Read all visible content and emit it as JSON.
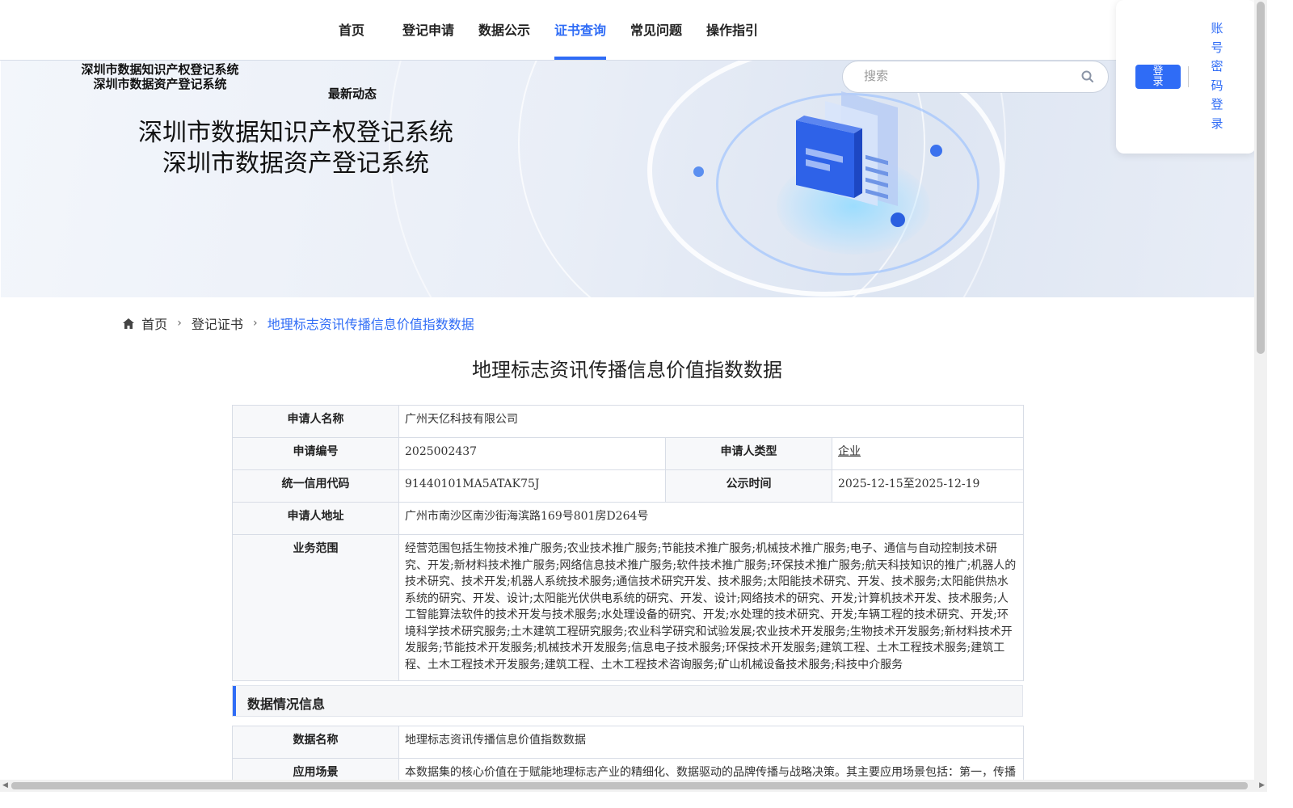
{
  "nav": {
    "items": [
      {
        "label": "首页"
      },
      {
        "label": "登记申请"
      },
      {
        "label": "数据公示"
      },
      {
        "label": "证书查询"
      },
      {
        "label": "常见问题"
      },
      {
        "label": "操作指引"
      }
    ],
    "active_index": 3
  },
  "banner": {
    "small_title_1": "深圳市数据知识产权登记系统",
    "small_title_2": "深圳市数据资产登记系统",
    "news": "最新动态",
    "big_title_1": "深圳市数据知识产权登记系统",
    "big_title_2": "深圳市数据资产登记系统"
  },
  "search": {
    "placeholder": "搜索",
    "icon": "search-icon"
  },
  "login": {
    "button_label": "登\n录",
    "password_login": "账号密码登录"
  },
  "breadcrumb": {
    "home": "首页",
    "level2": "登记证书",
    "current": "地理标志资讯传播信息价值指数数据"
  },
  "page_title": "地理标志资讯传播信息价值指数数据",
  "info": {
    "applicant_name_label": "申请人名称",
    "applicant_name": "广州天亿科技有限公司",
    "app_no_label": "申请编号",
    "app_no": "2025002437",
    "applicant_type_label": "申请人类型",
    "applicant_type": "企业",
    "credit_code_label": "统一信用代码",
    "credit_code": "91440101MA5ATAK75J",
    "publicity_label": "公示时间",
    "publicity": "2025-12-15至2025-12-19",
    "address_label": "申请人地址",
    "address": "广州市南沙区南沙街海滨路169号801房D264号",
    "scope_label": "业务范围",
    "scope": "经营范围包括生物技术推广服务;农业技术推广服务;节能技术推广服务;机械技术推广服务;电子、通信与自动控制技术研究、开发;新材料技术推广服务;网络信息技术推广服务;软件技术推广服务;环保技术推广服务;航天科技知识的推广;机器人的技术研究、技术开发;机器人系统技术服务;通信技术研究开发、技术服务;太阳能技术研究、开发、技术服务;太阳能供热水系统的研究、开发、设计;太阳能光伏供电系统的研究、开发、设计;网络技术的研究、开发;计算机技术开发、技术服务;人工智能算法软件的技术开发与技术服务;水处理设备的研究、开发;水处理的技术研究、开发;车辆工程的技术研究、开发;环境科学技术研究服务;土木建筑工程研究服务;农业科学研究和试验发展;农业技术开发服务;生物技术开发服务;新材料技术开发服务;节能技术开发服务;机械技术开发服务;信息电子技术服务;环保技术开发服务;建筑工程、土木工程技术服务;建筑工程、土木工程技术开发服务;建筑工程、土木工程技术咨询服务;矿山机械设备技术服务;科技中介服务"
  },
  "data_section": {
    "heading": "数据情况信息",
    "name_label": "数据名称",
    "name": "地理标志资讯传播信息价值指数数据",
    "scene_label": "应用场景",
    "scene": "本数据集的核心价值在于赋能地理标志产业的精细化、数据驱动的品牌传播与战略决策。其主要应用场景包括：第一，传播策略优化与内容创作指导，运营团队可通过分析阅读完成率、互动比、分享营销阅读比等……"
  },
  "colors": {
    "accent": "#2f6cf6"
  }
}
